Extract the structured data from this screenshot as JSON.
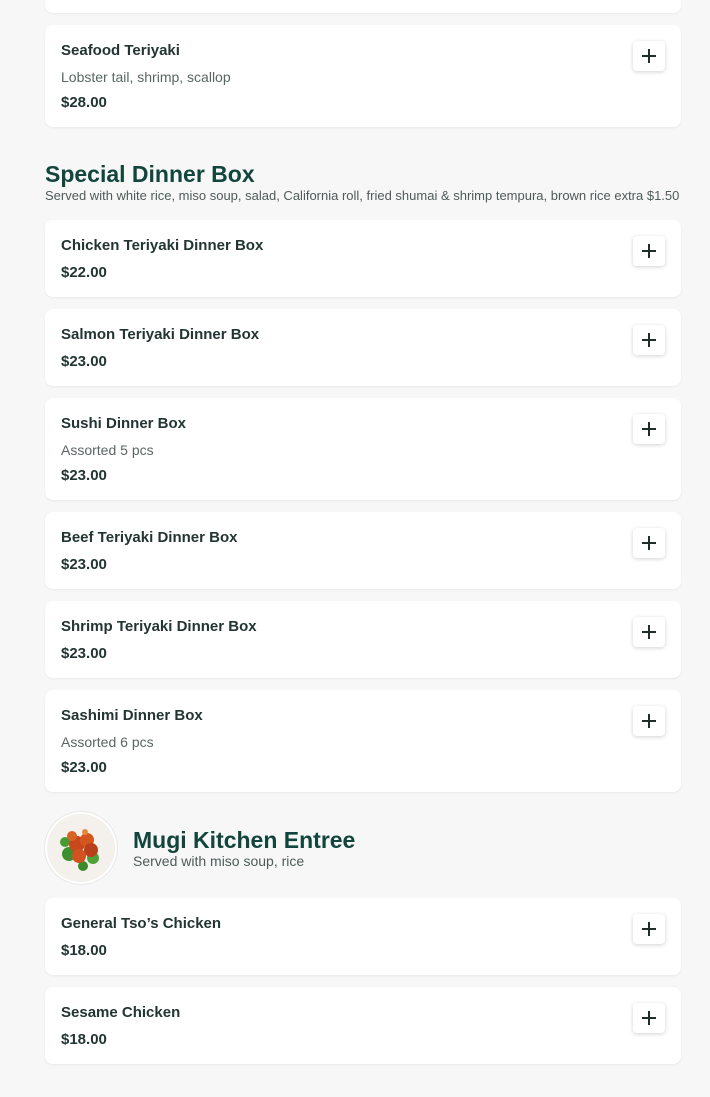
{
  "partial_top_card": {},
  "sections": [
    {
      "items": [
        {
          "name": "Seafood Teriyaki",
          "description": "Lobster tail, shrimp, scallop",
          "price": "$28.00"
        }
      ]
    },
    {
      "title": "Special Dinner Box",
      "subtitle": "Served with white rice, miso soup, salad, California roll, fried shumai & shrimp tempura, brown rice extra $1.50",
      "items": [
        {
          "name": "Chicken Teriyaki Dinner Box",
          "price": "$22.00"
        },
        {
          "name": "Salmon Teriyaki Dinner Box",
          "price": "$23.00"
        },
        {
          "name": "Sushi Dinner Box",
          "description": "Assorted 5 pcs",
          "price": "$23.00"
        },
        {
          "name": "Beef Teriyaki Dinner Box",
          "price": "$23.00"
        },
        {
          "name": "Shrimp Teriyaki Dinner Box",
          "price": "$23.00"
        },
        {
          "name": "Sashimi Dinner Box",
          "description": "Assorted 6 pcs",
          "price": "$23.00"
        }
      ]
    },
    {
      "title": "Mugi Kitchen Entree",
      "subtitle": "Served with miso soup, rice",
      "image_icon": "food-photo",
      "items": [
        {
          "name": "General Tso’s Chicken",
          "price": "$18.00"
        },
        {
          "name": "Sesame Chicken",
          "price": "$18.00"
        }
      ]
    }
  ],
  "icons": {
    "add": "plus-icon"
  },
  "colors": {
    "section_title": "#12453b",
    "card_bg": "#ffffff",
    "page_bg": "#f7f7f7"
  }
}
